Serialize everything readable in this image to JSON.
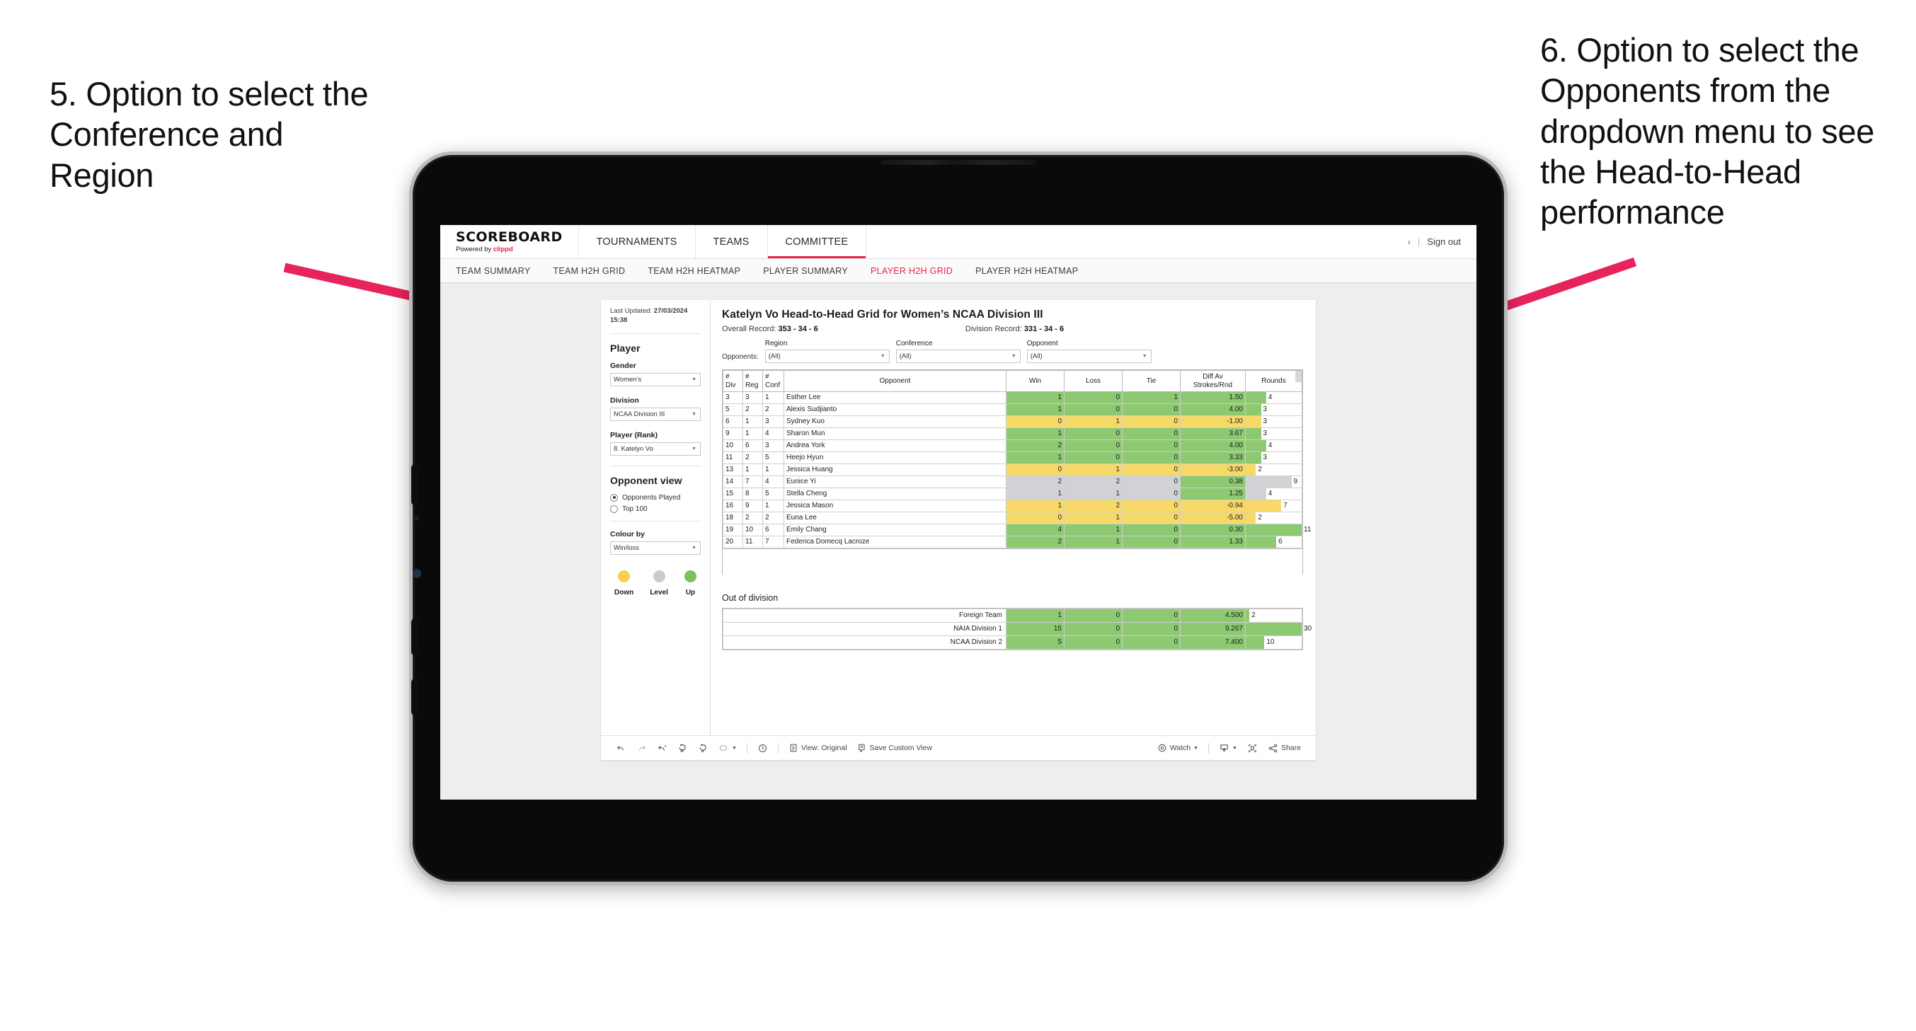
{
  "annotations": {
    "left": "5. Option to select the Conference and Region",
    "right": "6. Option to select the Opponents from the dropdown menu to see the Head-to-Head performance",
    "arrow_color": "#E8235C"
  },
  "app": {
    "brand": {
      "title": "SCOREBOARD",
      "powered_prefix": "Powered by ",
      "powered_brand": "clippd"
    },
    "top_nav": [
      {
        "label": "TOURNAMENTS",
        "active": false
      },
      {
        "label": "TEAMS",
        "active": false
      },
      {
        "label": "COMMITTEE",
        "active": true
      }
    ],
    "top_right": {
      "chevron": "›",
      "separator": "|",
      "sign_out": "Sign out"
    },
    "sub_nav": [
      {
        "label": "TEAM SUMMARY",
        "active": false
      },
      {
        "label": "TEAM H2H GRID",
        "active": false
      },
      {
        "label": "TEAM H2H HEATMAP",
        "active": false
      },
      {
        "label": "PLAYER SUMMARY",
        "active": false
      },
      {
        "label": "PLAYER H2H GRID",
        "active": true
      },
      {
        "label": "PLAYER H2H HEATMAP",
        "active": false
      }
    ]
  },
  "panel": {
    "last_updated_label": "Last Updated: ",
    "last_updated_value": "27/03/2024",
    "last_updated_time": "15:38",
    "section_player": "Player",
    "gender": {
      "label": "Gender",
      "value": "Women’s"
    },
    "division": {
      "label": "Division",
      "value": "NCAA Division III"
    },
    "player_rank": {
      "label": "Player (Rank)",
      "value": "8. Katelyn Vo"
    },
    "opponent_view": {
      "label": "Opponent view",
      "options": [
        {
          "label": "Opponents Played",
          "selected": true
        },
        {
          "label": "Top 100",
          "selected": false
        }
      ]
    },
    "colour_by": {
      "label": "Colour by",
      "value": "Win/loss"
    },
    "legend": [
      {
        "label": "Down",
        "color": "#F5D14E"
      },
      {
        "label": "Level",
        "color": "#C8CBD0"
      },
      {
        "label": "Up",
        "color": "#7CC15E"
      }
    ]
  },
  "viz": {
    "title": "Katelyn Vo Head-to-Head Grid for Women’s NCAA Division III",
    "overall_record_label": "Overall Record: ",
    "overall_record_value": "353 - 34 - 6",
    "division_record_label": "Division Record: ",
    "division_record_value": "331 - 34 - 6",
    "opponents_label": "Opponents:",
    "filters": [
      {
        "label": "Region",
        "value": "(All)"
      },
      {
        "label": "Conference",
        "value": "(All)"
      },
      {
        "label": "Opponent",
        "value": "(All)"
      }
    ],
    "out_of_division_title": "Out of division"
  },
  "chart_data": {
    "type": "table",
    "title": "Katelyn Vo Head-to-Head Grid for Women’s NCAA Division III",
    "columns": [
      "# Div",
      "# Reg",
      "# Conf",
      "Opponent",
      "Win",
      "Loss",
      "Tie",
      "Diff Av Strokes/Rnd",
      "Rounds"
    ],
    "column_headers_multiline": [
      [
        "#",
        "Div"
      ],
      [
        "#",
        "Reg"
      ],
      [
        "#",
        "Conf"
      ],
      [
        "Opponent"
      ],
      [
        "Win"
      ],
      [
        "Loss"
      ],
      [
        "Tie"
      ],
      [
        "Diff Av",
        "Strokes/Rnd"
      ],
      [
        "Rounds"
      ]
    ],
    "colour_by": "Win/loss",
    "colour_scale": {
      "down": "#F7D967",
      "level": "#D0D2D5",
      "up": "#8CC971"
    },
    "rounds_max": 11,
    "rows": [
      {
        "div": "3",
        "reg": "3",
        "conf": "1",
        "opponent": "Esther Lee",
        "win": "1",
        "loss": "0",
        "tie": "1",
        "diff": "1.50",
        "rounds": 4,
        "state": "up"
      },
      {
        "div": "5",
        "reg": "2",
        "conf": "2",
        "opponent": "Alexis Sudjianto",
        "win": "1",
        "loss": "0",
        "tie": "0",
        "diff": "4.00",
        "rounds": 3,
        "state": "up"
      },
      {
        "div": "6",
        "reg": "1",
        "conf": "3",
        "opponent": "Sydney Kuo",
        "win": "0",
        "loss": "1",
        "tie": "0",
        "diff": "-1.00",
        "rounds": 3,
        "state": "down"
      },
      {
        "div": "9",
        "reg": "1",
        "conf": "4",
        "opponent": "Sharon Mun",
        "win": "1",
        "loss": "0",
        "tie": "0",
        "diff": "3.67",
        "rounds": 3,
        "state": "up"
      },
      {
        "div": "10",
        "reg": "6",
        "conf": "3",
        "opponent": "Andrea York",
        "win": "2",
        "loss": "0",
        "tie": "0",
        "diff": "4.00",
        "rounds": 4,
        "state": "up"
      },
      {
        "div": "11",
        "reg": "2",
        "conf": "5",
        "opponent": "Heejo Hyun",
        "win": "1",
        "loss": "0",
        "tie": "0",
        "diff": "3.33",
        "rounds": 3,
        "state": "up"
      },
      {
        "div": "13",
        "reg": "1",
        "conf": "1",
        "opponent": "Jessica Huang",
        "win": "0",
        "loss": "1",
        "tie": "0",
        "diff": "-3.00",
        "rounds": 2,
        "state": "down"
      },
      {
        "div": "14",
        "reg": "7",
        "conf": "4",
        "opponent": "Eunice Yi",
        "win": "2",
        "loss": "2",
        "tie": "0",
        "diff": "0.38",
        "rounds": 9,
        "state": "level",
        "diff_state": "up"
      },
      {
        "div": "15",
        "reg": "8",
        "conf": "5",
        "opponent": "Stella Cheng",
        "win": "1",
        "loss": "1",
        "tie": "0",
        "diff": "1.25",
        "rounds": 4,
        "state": "level",
        "diff_state": "up"
      },
      {
        "div": "16",
        "reg": "9",
        "conf": "1",
        "opponent": "Jessica Mason",
        "win": "1",
        "loss": "2",
        "tie": "0",
        "diff": "-0.94",
        "rounds": 7,
        "state": "down"
      },
      {
        "div": "18",
        "reg": "2",
        "conf": "2",
        "opponent": "Euna Lee",
        "win": "0",
        "loss": "1",
        "tie": "0",
        "diff": "-5.00",
        "rounds": 2,
        "state": "down"
      },
      {
        "div": "19",
        "reg": "10",
        "conf": "6",
        "opponent": "Emily Chang",
        "win": "4",
        "loss": "1",
        "tie": "0",
        "diff": "0.30",
        "rounds": 11,
        "state": "up"
      },
      {
        "div": "20",
        "reg": "11",
        "conf": "7",
        "opponent": "Federica Domecq Lacroze",
        "win": "2",
        "loss": "1",
        "tie": "0",
        "diff": "1.33",
        "rounds": 6,
        "state": "up"
      }
    ],
    "out_of_division": {
      "rounds_max": 30,
      "rows": [
        {
          "name": "Foreign Team",
          "win": "1",
          "loss": "0",
          "tie": "0",
          "diff": "4.500",
          "rounds": 2,
          "state": "up"
        },
        {
          "name": "NAIA Division 1",
          "win": "15",
          "loss": "0",
          "tie": "0",
          "diff": "9.267",
          "rounds": 30,
          "state": "up"
        },
        {
          "name": "NCAA Division 2",
          "win": "5",
          "loss": "0",
          "tie": "0",
          "diff": "7.400",
          "rounds": 10,
          "state": "up"
        }
      ]
    }
  },
  "toolbar": {
    "undo": "undo-icon",
    "redo": "redo-icon",
    "revert": "revert-icon",
    "refresh": "refresh-icon",
    "pause": "pause-icon",
    "fit": "fit-icon",
    "history": "history-icon",
    "view_label": "View: Original",
    "save_label": "Save Custom View",
    "watch_label": "Watch",
    "download": "download-icon",
    "fullscreen": "fullscreen-icon",
    "share_label": "Share"
  }
}
